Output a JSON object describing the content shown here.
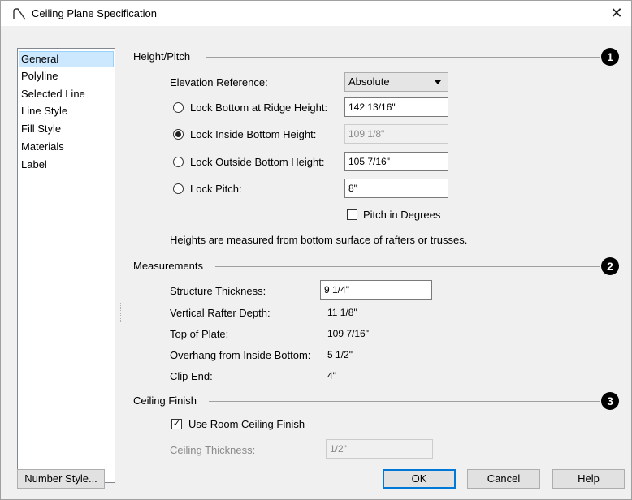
{
  "window": {
    "title": "Ceiling Plane Specification",
    "close_glyph": "✕"
  },
  "sidebar": {
    "items": [
      {
        "label": "General",
        "selected": true
      },
      {
        "label": "Polyline"
      },
      {
        "label": "Selected Line"
      },
      {
        "label": "Line Style"
      },
      {
        "label": "Fill Style"
      },
      {
        "label": "Materials"
      },
      {
        "label": "Label"
      }
    ]
  },
  "height_pitch": {
    "title": "Height/Pitch",
    "callout": "1",
    "elevation_reference_label": "Elevation Reference:",
    "elevation_reference_value": "Absolute",
    "lock_bottom_ridge_label": "Lock Bottom at Ridge Height:",
    "lock_bottom_ridge_value": "142 13/16\"",
    "lock_inside_bottom_label": "Lock Inside Bottom Height:",
    "lock_inside_bottom_value": "109 1/8\"",
    "lock_outside_bottom_label": "Lock Outside Bottom Height:",
    "lock_outside_bottom_value": "105 7/16\"",
    "lock_pitch_label": "Lock Pitch:",
    "lock_pitch_value": "8\"",
    "pitch_in_degrees_label": "Pitch in Degrees",
    "note": "Heights are measured from bottom surface of rafters or trusses."
  },
  "measurements": {
    "title": "Measurements",
    "callout": "2",
    "structure_thickness_label": "Structure Thickness:",
    "structure_thickness_value": "9 1/4\"",
    "vertical_rafter_depth_label": "Vertical Rafter Depth:",
    "vertical_rafter_depth_value": "11 1/8\"",
    "top_of_plate_label": "Top of Plate:",
    "top_of_plate_value": "109 7/16\"",
    "overhang_label": "Overhang from Inside Bottom:",
    "overhang_value": "5 1/2\"",
    "clip_end_label": "Clip End:",
    "clip_end_value": "4\""
  },
  "ceiling_finish": {
    "title": "Ceiling Finish",
    "callout": "3",
    "use_room_finish_label": "Use Room Ceiling Finish",
    "check_glyph": "✓",
    "ceiling_thickness_label": "Ceiling Thickness:",
    "ceiling_thickness_value": "1/2\""
  },
  "buttons": {
    "number_style": "Number Style...",
    "ok": "OK",
    "cancel": "Cancel",
    "help": "Help"
  }
}
